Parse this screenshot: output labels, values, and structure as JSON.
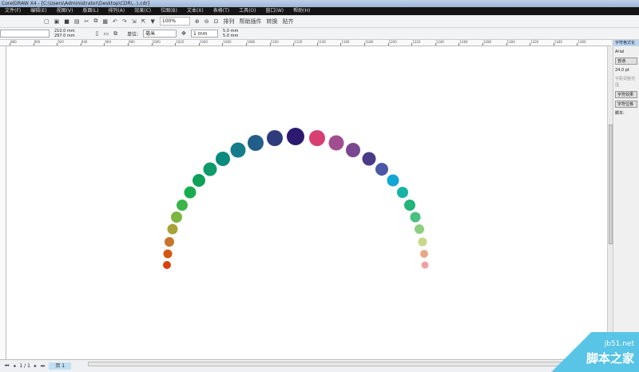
{
  "window": {
    "title": "CorelDRAW X4 - [C:\\Users\\Administrator\\Desktop\\CDR\\...\\.cdr]"
  },
  "menu": [
    "文件(F)",
    "编辑(E)",
    "视图(V)",
    "版面(L)",
    "排列(A)",
    "效果(C)",
    "位图(B)",
    "文本(X)",
    "表格(T)",
    "工具(O)",
    "窗口(W)",
    "帮助(H)"
  ],
  "toolbar": {
    "zoom": "100%",
    "snap_label": "贴齐",
    "items": [
      "排列",
      "帮助插件",
      "转换",
      "贴齐"
    ]
  },
  "propbar": {
    "width": "210.0 mm",
    "height": "297.0 mm",
    "units_label": "单位:",
    "units": "毫米",
    "nudge": "1 mm",
    "dup_x": "5.0 mm",
    "dup_y": "5.0 mm"
  },
  "ruler": {
    "labels": [
      "880",
      "900",
      "920",
      "940",
      "960",
      "980",
      "1000",
      "1020",
      "1040",
      "1060",
      "1080",
      "1100",
      "1120",
      "1140",
      "1160",
      "1180",
      "1200",
      "1220",
      "1240",
      "1260",
      "1280",
      "1300",
      "1320",
      "1340",
      "1360"
    ]
  },
  "docker": {
    "title": "字符格式化",
    "font": "Arial",
    "style": "普通",
    "size": "24.0 pt",
    "hint": "字距调整范围",
    "btn1": "字符效果",
    "btn2": "字符位移",
    "script_label": "脚本:"
  },
  "status": {
    "page": "1 / 1",
    "page_tab": "页 1"
  },
  "watermark": {
    "site": "jb51.net",
    "name": "脚本之家"
  },
  "dots": [
    "#d9400c",
    "#d45612",
    "#c8742a",
    "#a8a23a",
    "#7cb540",
    "#3cb44a",
    "#18ad50",
    "#10a058",
    "#0e9a6a",
    "#0a8b7e",
    "#177c8a",
    "#235e8a",
    "#2e3c7c",
    "#2c1a70",
    "#d83e72",
    "#a04e90",
    "#7a4690",
    "#4a3a88",
    "#4a58a6",
    "#12a6d4",
    "#16b4a4",
    "#22b478",
    "#48c080",
    "#8ccf80",
    "#c8d888",
    "#e8a888",
    "#f0a0a4"
  ]
}
